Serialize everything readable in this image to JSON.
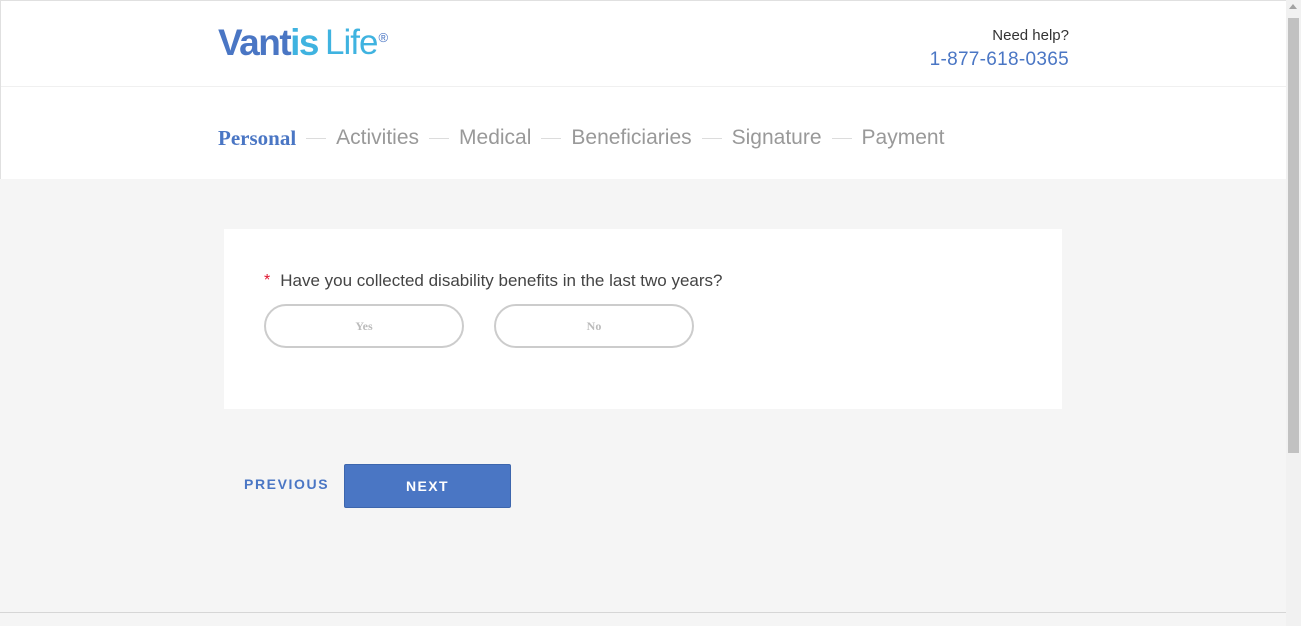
{
  "brand": {
    "part1": "Vant",
    "part2": "is",
    "part3": "Life",
    "reg": "®"
  },
  "help": {
    "label": "Need help?",
    "phone": "1-877-618-0365"
  },
  "steps": [
    {
      "label": "Personal",
      "active": true
    },
    {
      "label": "Activities",
      "active": false
    },
    {
      "label": "Medical",
      "active": false
    },
    {
      "label": "Beneficiaries",
      "active": false
    },
    {
      "label": "Signature",
      "active": false
    },
    {
      "label": "Payment",
      "active": false
    }
  ],
  "question": {
    "required_mark": "*",
    "text": "Have you collected disability benefits in the last two years?",
    "options": {
      "yes": "Yes",
      "no": "No"
    }
  },
  "nav": {
    "previous": "PREVIOUS",
    "next": "NEXT"
  },
  "colors": {
    "accent": "#4a76c4",
    "logo_light": "#3fb3e0",
    "required": "#e0142f"
  }
}
